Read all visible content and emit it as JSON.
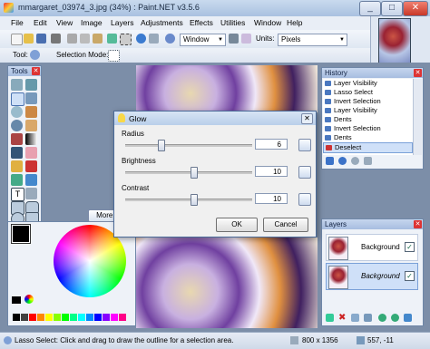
{
  "window": {
    "title": "mmargaret_03974_3.jpg (34%) : Paint.NET v3.5.6",
    "minimize": "_",
    "maximize": "□",
    "close": "✕"
  },
  "menu": [
    "File",
    "Edit",
    "View",
    "Image",
    "Layers",
    "Adjustments",
    "Effects",
    "Utilities",
    "Window",
    "Help"
  ],
  "toolbar": {
    "zoom_value": "Window",
    "units_label": "Units:",
    "units_value": "Pixels",
    "tool_label": "Tool:",
    "selection_mode_label": "Selection Mode:"
  },
  "tools_panel": {
    "title": "Tools"
  },
  "colors_panel": {
    "more_button": "More >>"
  },
  "history": {
    "title": "History",
    "items": [
      "Layer Visibility",
      "Lasso Select",
      "Invert Selection",
      "Layer Visibility",
      "Dents",
      "Invert Selection",
      "Dents",
      "Deselect"
    ],
    "selected_index": 7
  },
  "layers": {
    "title": "Layers",
    "items": [
      {
        "name": "Background",
        "checked": true
      },
      {
        "name": "Background",
        "checked": true,
        "selected": true
      }
    ]
  },
  "glow": {
    "title": "Glow",
    "radius_label": "Radius",
    "radius_value": "6",
    "brightness_label": "Brightness",
    "brightness_value": "10",
    "contrast_label": "Contrast",
    "contrast_value": "10",
    "ok": "OK",
    "cancel": "Cancel"
  },
  "status": {
    "text": "Lasso Select: Click and drag to draw the outline for a selection area.",
    "size": "800 x 1356",
    "position": "557, -11"
  },
  "colors": {
    "accent": "#a9c1e0",
    "panel": "#eef2f8",
    "workspace": "#7c8ea8"
  }
}
